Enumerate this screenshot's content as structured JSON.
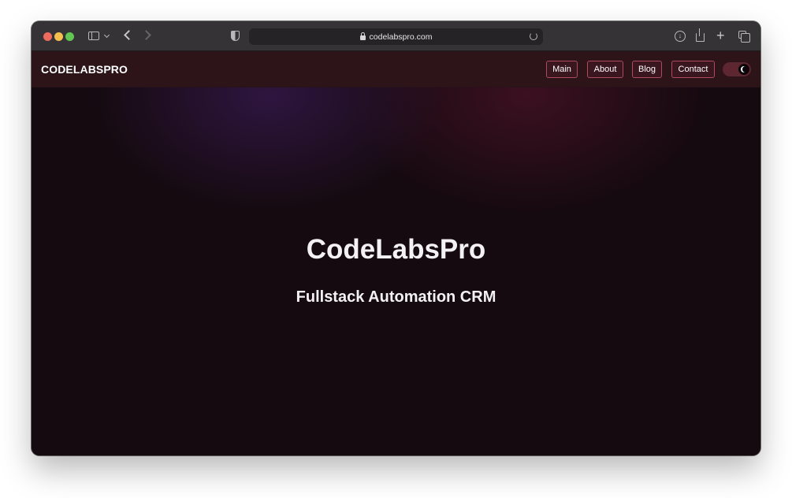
{
  "browser": {
    "url": "codelabspro.com",
    "icons": {
      "close": "red-dot",
      "minimize": "yellow-dot",
      "zoom": "green-dot",
      "sidebar": "sidebar-icon",
      "back": "chevron-left-icon",
      "forward": "chevron-right-icon",
      "privacy": "shield-icon",
      "secure": "lock-icon",
      "reload": "reload-icon",
      "downloads": "download-icon",
      "share": "share-icon",
      "new_tab": "plus-icon",
      "tab_overview": "tabs-icon"
    }
  },
  "site": {
    "brand": "CODELABSPRO",
    "nav": [
      {
        "label": "Main"
      },
      {
        "label": "About"
      },
      {
        "label": "Blog"
      },
      {
        "label": "Contact"
      }
    ],
    "theme_toggle": {
      "state": "dark",
      "icon": "moon-icon"
    }
  },
  "hero": {
    "title": "CodeLabsPro",
    "subtitle": "Fullstack Automation CRM"
  },
  "colors": {
    "accent_border": "#b04a5e",
    "header_bg": "#2c1419",
    "hero_bg": "#150a0f",
    "text": "#f3f1f3"
  }
}
